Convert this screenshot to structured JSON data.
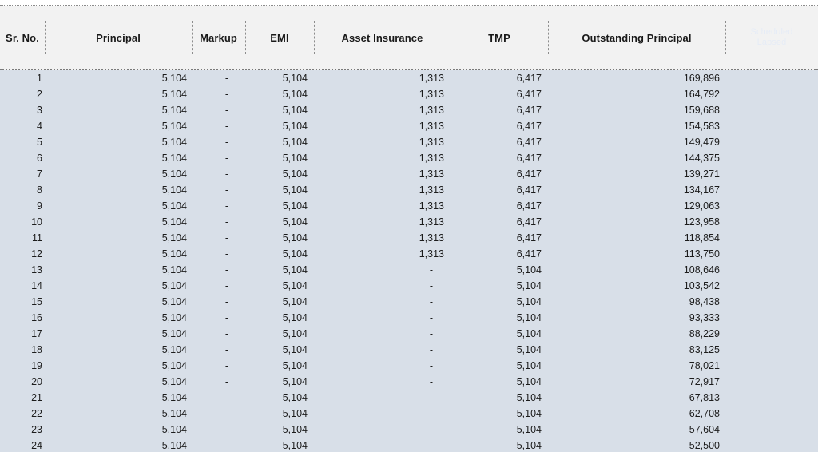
{
  "headers": {
    "sr": "Sr. No.",
    "principal": "Principal",
    "markup": "Markup",
    "emi": "EMI",
    "asset_insurance": "Asset Insurance",
    "tmp": "TMP",
    "outstanding": "Outstanding Principal",
    "ghost_line1": "Scheduled",
    "ghost_line2": "Lapsed"
  },
  "rows": [
    {
      "sr": "1",
      "principal": "5,104",
      "markup": "-",
      "emi": "5,104",
      "ai": "1,313",
      "tmp": "6,417",
      "op": "169,896"
    },
    {
      "sr": "2",
      "principal": "5,104",
      "markup": "-",
      "emi": "5,104",
      "ai": "1,313",
      "tmp": "6,417",
      "op": "164,792"
    },
    {
      "sr": "3",
      "principal": "5,104",
      "markup": "-",
      "emi": "5,104",
      "ai": "1,313",
      "tmp": "6,417",
      "op": "159,688"
    },
    {
      "sr": "4",
      "principal": "5,104",
      "markup": "-",
      "emi": "5,104",
      "ai": "1,313",
      "tmp": "6,417",
      "op": "154,583"
    },
    {
      "sr": "5",
      "principal": "5,104",
      "markup": "-",
      "emi": "5,104",
      "ai": "1,313",
      "tmp": "6,417",
      "op": "149,479"
    },
    {
      "sr": "6",
      "principal": "5,104",
      "markup": "-",
      "emi": "5,104",
      "ai": "1,313",
      "tmp": "6,417",
      "op": "144,375"
    },
    {
      "sr": "7",
      "principal": "5,104",
      "markup": "-",
      "emi": "5,104",
      "ai": "1,313",
      "tmp": "6,417",
      "op": "139,271"
    },
    {
      "sr": "8",
      "principal": "5,104",
      "markup": "-",
      "emi": "5,104",
      "ai": "1,313",
      "tmp": "6,417",
      "op": "134,167"
    },
    {
      "sr": "9",
      "principal": "5,104",
      "markup": "-",
      "emi": "5,104",
      "ai": "1,313",
      "tmp": "6,417",
      "op": "129,063"
    },
    {
      "sr": "10",
      "principal": "5,104",
      "markup": "-",
      "emi": "5,104",
      "ai": "1,313",
      "tmp": "6,417",
      "op": "123,958"
    },
    {
      "sr": "11",
      "principal": "5,104",
      "markup": "-",
      "emi": "5,104",
      "ai": "1,313",
      "tmp": "6,417",
      "op": "118,854"
    },
    {
      "sr": "12",
      "principal": "5,104",
      "markup": "-",
      "emi": "5,104",
      "ai": "1,313",
      "tmp": "6,417",
      "op": "113,750"
    },
    {
      "sr": "13",
      "principal": "5,104",
      "markup": "-",
      "emi": "5,104",
      "ai": "-",
      "tmp": "5,104",
      "op": "108,646"
    },
    {
      "sr": "14",
      "principal": "5,104",
      "markup": "-",
      "emi": "5,104",
      "ai": "-",
      "tmp": "5,104",
      "op": "103,542"
    },
    {
      "sr": "15",
      "principal": "5,104",
      "markup": "-",
      "emi": "5,104",
      "ai": "-",
      "tmp": "5,104",
      "op": "98,438"
    },
    {
      "sr": "16",
      "principal": "5,104",
      "markup": "-",
      "emi": "5,104",
      "ai": "-",
      "tmp": "5,104",
      "op": "93,333"
    },
    {
      "sr": "17",
      "principal": "5,104",
      "markup": "-",
      "emi": "5,104",
      "ai": "-",
      "tmp": "5,104",
      "op": "88,229"
    },
    {
      "sr": "18",
      "principal": "5,104",
      "markup": "-",
      "emi": "5,104",
      "ai": "-",
      "tmp": "5,104",
      "op": "83,125"
    },
    {
      "sr": "19",
      "principal": "5,104",
      "markup": "-",
      "emi": "5,104",
      "ai": "-",
      "tmp": "5,104",
      "op": "78,021"
    },
    {
      "sr": "20",
      "principal": "5,104",
      "markup": "-",
      "emi": "5,104",
      "ai": "-",
      "tmp": "5,104",
      "op": "72,917"
    },
    {
      "sr": "21",
      "principal": "5,104",
      "markup": "-",
      "emi": "5,104",
      "ai": "-",
      "tmp": "5,104",
      "op": "67,813"
    },
    {
      "sr": "22",
      "principal": "5,104",
      "markup": "-",
      "emi": "5,104",
      "ai": "-",
      "tmp": "5,104",
      "op": "62,708"
    },
    {
      "sr": "23",
      "principal": "5,104",
      "markup": "-",
      "emi": "5,104",
      "ai": "-",
      "tmp": "5,104",
      "op": "57,604"
    },
    {
      "sr": "24",
      "principal": "5,104",
      "markup": "-",
      "emi": "5,104",
      "ai": "-",
      "tmp": "5,104",
      "op": "52,500"
    }
  ],
  "colors": {
    "header_bg": "#f2f2f2",
    "body_bg": "#d8dfe8"
  }
}
